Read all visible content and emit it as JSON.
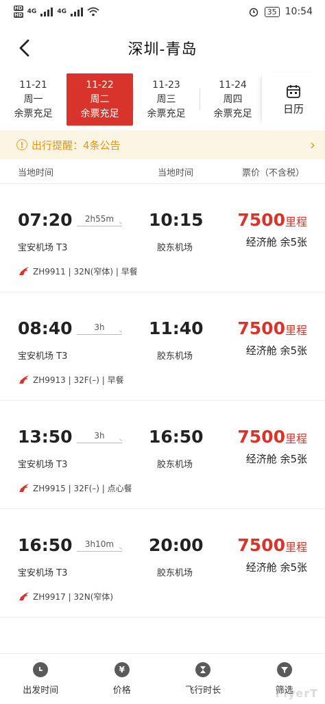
{
  "status_bar": {
    "network_1": "4G",
    "network_2": "4G",
    "battery": "35",
    "time": "10:54"
  },
  "header": {
    "title": "深圳-青岛"
  },
  "dates": [
    {
      "date": "11-21",
      "weekday": "周一",
      "status": "余票充足",
      "active": false
    },
    {
      "date": "11-22",
      "weekday": "周二",
      "status": "余票充足",
      "active": true
    },
    {
      "date": "11-23",
      "weekday": "周三",
      "status": "余票充足",
      "active": false
    },
    {
      "date": "11-24",
      "weekday": "周四",
      "status": "余票充足",
      "active": false
    }
  ],
  "calendar": {
    "label": "日历"
  },
  "notice": {
    "text": "出行提醒：4条公告"
  },
  "columns": {
    "dep": "当地时间",
    "arr": "当地时间",
    "price": "票价（不含税）"
  },
  "flights": [
    {
      "dep_time": "07:20",
      "duration": "2h55m",
      "arr_time": "10:15",
      "dep_airport": "宝安机场 T3",
      "arr_airport": "胶东机场",
      "price": "7500",
      "unit": "里程",
      "cabin": "经济舱 余5张",
      "info": "ZH9911 | 32N(窄体) | 早餐"
    },
    {
      "dep_time": "08:40",
      "duration": "3h",
      "arr_time": "11:40",
      "dep_airport": "宝安机场 T3",
      "arr_airport": "胶东机场",
      "price": "7500",
      "unit": "里程",
      "cabin": "经济舱 余5张",
      "info": "ZH9913 | 32F(–) | 早餐"
    },
    {
      "dep_time": "13:50",
      "duration": "3h",
      "arr_time": "16:50",
      "dep_airport": "宝安机场 T3",
      "arr_airport": "胶东机场",
      "price": "7500",
      "unit": "里程",
      "cabin": "经济舱 余5张",
      "info": "ZH9915 | 32F(–) | 点心餐"
    },
    {
      "dep_time": "16:50",
      "duration": "3h10m",
      "arr_time": "20:00",
      "dep_airport": "宝安机场 T3",
      "arr_airport": "胶东机场",
      "price": "7500",
      "unit": "里程",
      "cabin": "经济舱 余5张",
      "info": "ZH9917 | 32N(窄体)"
    }
  ],
  "tabs": [
    {
      "label": "出发时间",
      "icon": "clock-icon"
    },
    {
      "label": "价格",
      "icon": "yen-icon"
    },
    {
      "label": "飞行时长",
      "icon": "hourglass-icon"
    },
    {
      "label": "筛选",
      "icon": "filter-icon"
    }
  ],
  "watermark": "FlyerT"
}
